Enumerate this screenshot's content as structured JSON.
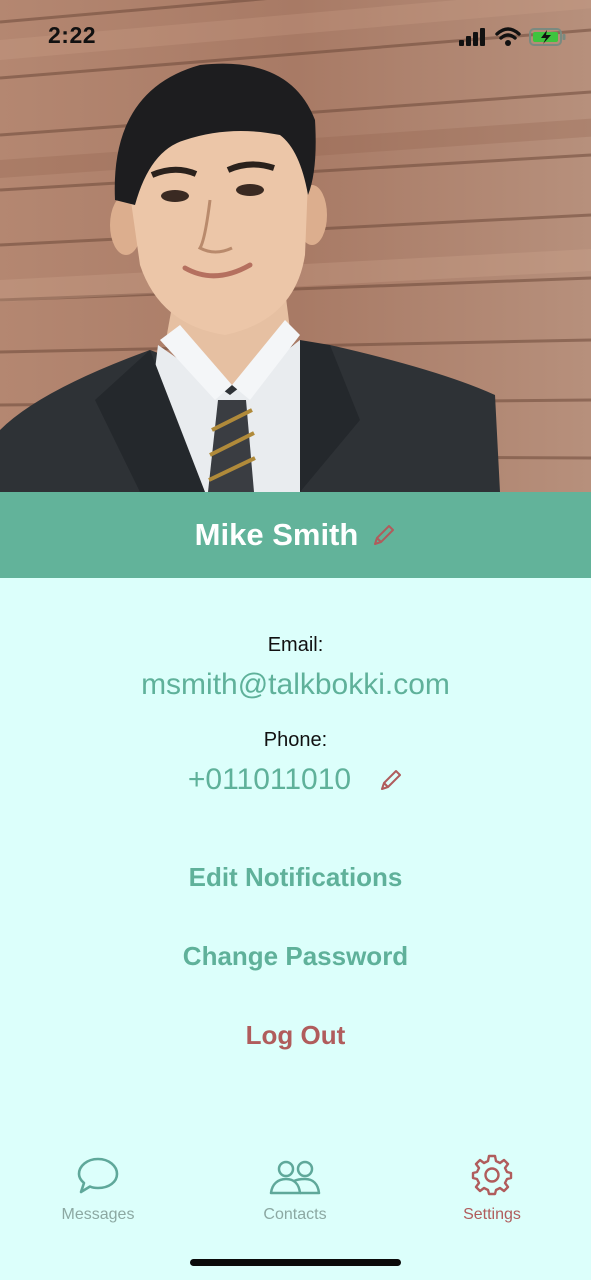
{
  "status_bar": {
    "time": "2:22",
    "icons": [
      "signal-icon",
      "wifi-icon",
      "battery-charging-icon"
    ]
  },
  "profile": {
    "name": "Mike Smith",
    "photo": "profile-photo",
    "email_label": "Email:",
    "email_value": "msmith@talkbokki.com",
    "phone_label": "Phone:",
    "phone_value": "+011011010"
  },
  "actions": {
    "edit_notifications": "Edit Notifications",
    "change_password": "Change Password",
    "log_out": "Log Out"
  },
  "tabs": [
    {
      "label": "Messages",
      "icon": "chat-bubble-icon",
      "active": false
    },
    {
      "label": "Contacts",
      "icon": "people-icon",
      "active": false
    },
    {
      "label": "Settings",
      "icon": "gear-icon",
      "active": true
    }
  ],
  "colors": {
    "header_bar": "#62b39a",
    "accent": "#5fb19a",
    "danger": "#b05c5c",
    "background": "#dcfffb"
  }
}
